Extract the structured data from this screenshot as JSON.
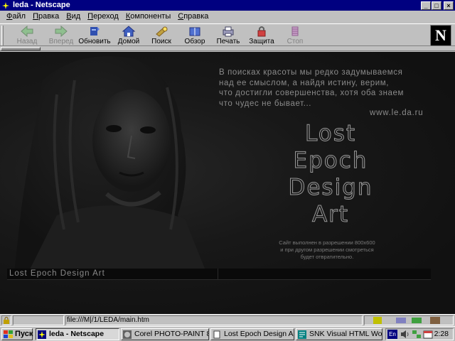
{
  "window": {
    "title": "leda - Netscape"
  },
  "menu": [
    {
      "label": "Файл",
      "ul": "Ф",
      "rest": "айл"
    },
    {
      "label": "Правка",
      "ul": "П",
      "rest": "равка"
    },
    {
      "label": "Вид",
      "ul": "В",
      "rest": "ид"
    },
    {
      "label": "Переход",
      "ul": "П",
      "rest": "ереход"
    },
    {
      "label": "Компоненты",
      "ul": "К",
      "rest": "омпоненты"
    },
    {
      "label": "Справка",
      "ul": "С",
      "rest": "правка"
    }
  ],
  "toolbar": {
    "back": "Назад",
    "forward": "Вперед",
    "reload": "Обновить",
    "home": "Домой",
    "search": "Поиск",
    "guide": "Обзор",
    "print": "Печать",
    "security": "Защита",
    "stop": "Стоп"
  },
  "page": {
    "quote_lines": [
      "В поисках красоты мы редко задумываемся",
      "над ее смыслом, а найдя истину, верим,",
      "что достигли совершенства, хотя оба знаем",
      "что чудес не бывает..."
    ],
    "site_url": "www.le.da.ru",
    "logo_lines": [
      "Lost",
      "Epoch",
      "Design",
      "Art"
    ],
    "resolution_lines": [
      "Сайт выполнен в разрешении 800x600",
      "и при другом разрешении смотреться",
      "будет отвратительно."
    ],
    "footer_title": "Lost Epoch Design Art"
  },
  "status": {
    "url": "file:///M|/1/LEDA/main.htm"
  },
  "taskbar": {
    "start": "Пуск",
    "tasks": [
      "leda - Netscape",
      "Corel PHOTO-PAINT 8 - ...",
      "Lost Epoch Design Art | ...",
      "SNK Visual HTML Work..."
    ],
    "lang": "En",
    "clock": "2:28"
  },
  "colors": {
    "titlebar": "#000080",
    "chrome": "#c0c0c0",
    "page_bg": "#141414"
  }
}
